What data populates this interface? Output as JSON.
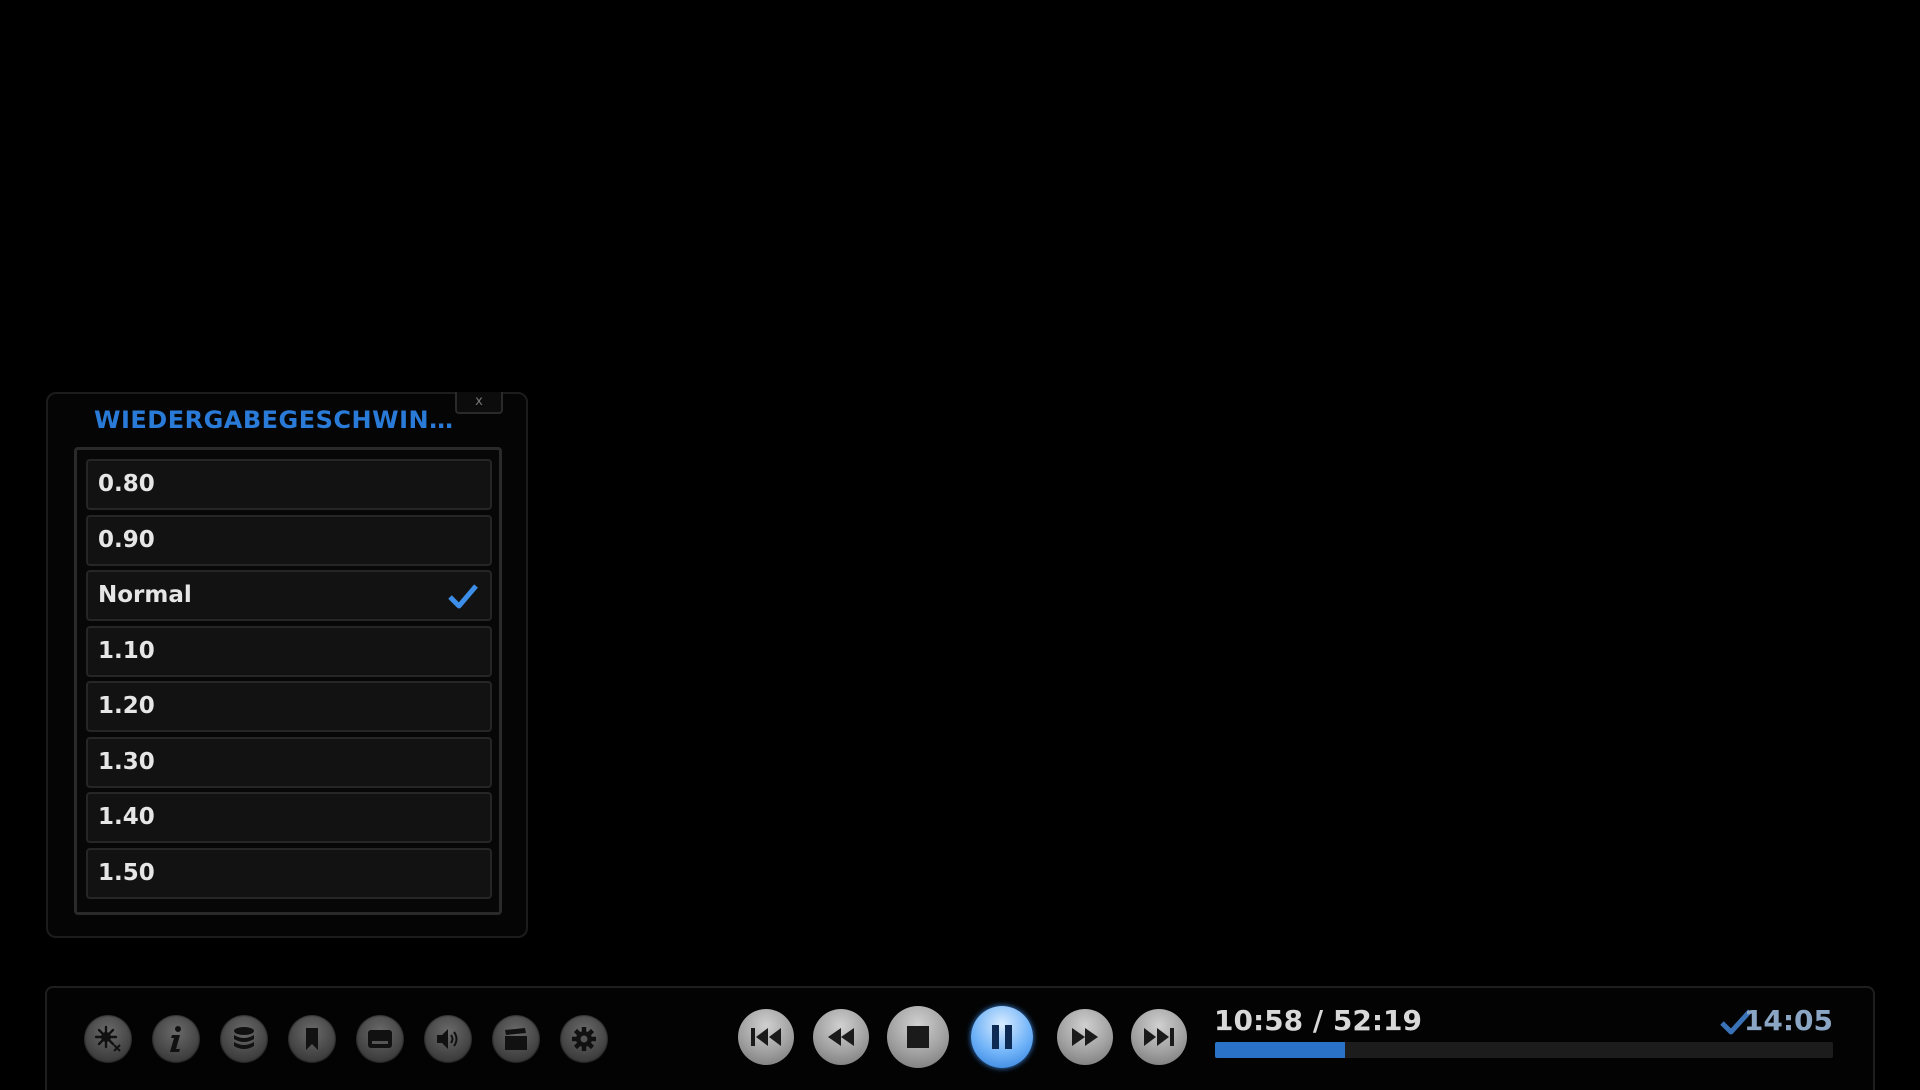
{
  "dialog": {
    "title": "WIEDERGABEGESCHWINDIGKEIT",
    "close_label": "x",
    "items": [
      {
        "label": "0.80",
        "selected": false
      },
      {
        "label": "0.90",
        "selected": false
      },
      {
        "label": "Normal",
        "selected": true
      },
      {
        "label": "1.10",
        "selected": false
      },
      {
        "label": "1.20",
        "selected": false
      },
      {
        "label": "1.30",
        "selected": false
      },
      {
        "label": "1.40",
        "selected": false
      },
      {
        "label": "1.50",
        "selected": false
      }
    ]
  },
  "osd": {
    "left_buttons": [
      "effects-off-icon",
      "info-icon",
      "layers-icon",
      "bookmark-icon",
      "subtitles-icon",
      "audio-icon",
      "video-clapper-icon",
      "settings-gear-icon"
    ],
    "transport_buttons": [
      "skip-previous-icon",
      "rewind-icon",
      "stop-icon",
      "pause-icon",
      "fast-forward-icon",
      "skip-next-icon"
    ],
    "active_button": "pause-icon",
    "time": "10:58 / 52:19",
    "progress_fraction": 0.21,
    "clock": "14:05"
  },
  "colors": {
    "accent": "#2a7ad8",
    "clock": "#8aa6c4",
    "background": "#000000"
  }
}
